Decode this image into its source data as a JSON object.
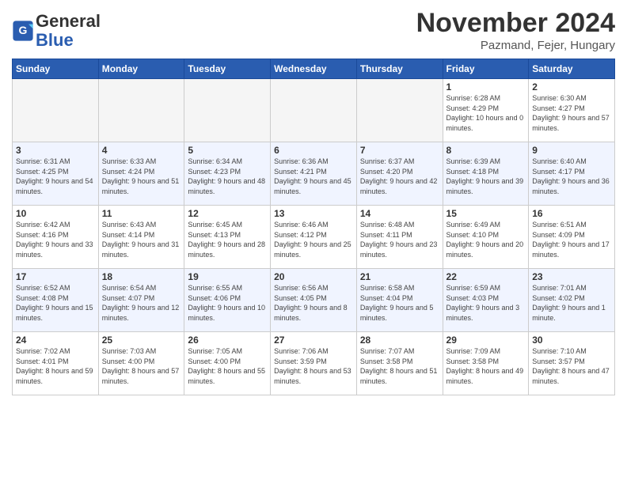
{
  "header": {
    "logo_text_general": "General",
    "logo_text_blue": "Blue",
    "month": "November 2024",
    "location": "Pazmand, Fejer, Hungary"
  },
  "weekdays": [
    "Sunday",
    "Monday",
    "Tuesday",
    "Wednesday",
    "Thursday",
    "Friday",
    "Saturday"
  ],
  "weeks": [
    [
      {
        "day": "",
        "sunrise": "",
        "sunset": "",
        "daylight": "",
        "empty": true
      },
      {
        "day": "",
        "sunrise": "",
        "sunset": "",
        "daylight": "",
        "empty": true
      },
      {
        "day": "",
        "sunrise": "",
        "sunset": "",
        "daylight": "",
        "empty": true
      },
      {
        "day": "",
        "sunrise": "",
        "sunset": "",
        "daylight": "",
        "empty": true
      },
      {
        "day": "",
        "sunrise": "",
        "sunset": "",
        "daylight": "",
        "empty": true
      },
      {
        "day": "1",
        "sunrise": "Sunrise: 6:28 AM",
        "sunset": "Sunset: 4:29 PM",
        "daylight": "Daylight: 10 hours and 0 minutes.",
        "empty": false
      },
      {
        "day": "2",
        "sunrise": "Sunrise: 6:30 AM",
        "sunset": "Sunset: 4:27 PM",
        "daylight": "Daylight: 9 hours and 57 minutes.",
        "empty": false
      }
    ],
    [
      {
        "day": "3",
        "sunrise": "Sunrise: 6:31 AM",
        "sunset": "Sunset: 4:25 PM",
        "daylight": "Daylight: 9 hours and 54 minutes.",
        "empty": false
      },
      {
        "day": "4",
        "sunrise": "Sunrise: 6:33 AM",
        "sunset": "Sunset: 4:24 PM",
        "daylight": "Daylight: 9 hours and 51 minutes.",
        "empty": false
      },
      {
        "day": "5",
        "sunrise": "Sunrise: 6:34 AM",
        "sunset": "Sunset: 4:23 PM",
        "daylight": "Daylight: 9 hours and 48 minutes.",
        "empty": false
      },
      {
        "day": "6",
        "sunrise": "Sunrise: 6:36 AM",
        "sunset": "Sunset: 4:21 PM",
        "daylight": "Daylight: 9 hours and 45 minutes.",
        "empty": false
      },
      {
        "day": "7",
        "sunrise": "Sunrise: 6:37 AM",
        "sunset": "Sunset: 4:20 PM",
        "daylight": "Daylight: 9 hours and 42 minutes.",
        "empty": false
      },
      {
        "day": "8",
        "sunrise": "Sunrise: 6:39 AM",
        "sunset": "Sunset: 4:18 PM",
        "daylight": "Daylight: 9 hours and 39 minutes.",
        "empty": false
      },
      {
        "day": "9",
        "sunrise": "Sunrise: 6:40 AM",
        "sunset": "Sunset: 4:17 PM",
        "daylight": "Daylight: 9 hours and 36 minutes.",
        "empty": false
      }
    ],
    [
      {
        "day": "10",
        "sunrise": "Sunrise: 6:42 AM",
        "sunset": "Sunset: 4:16 PM",
        "daylight": "Daylight: 9 hours and 33 minutes.",
        "empty": false
      },
      {
        "day": "11",
        "sunrise": "Sunrise: 6:43 AM",
        "sunset": "Sunset: 4:14 PM",
        "daylight": "Daylight: 9 hours and 31 minutes.",
        "empty": false
      },
      {
        "day": "12",
        "sunrise": "Sunrise: 6:45 AM",
        "sunset": "Sunset: 4:13 PM",
        "daylight": "Daylight: 9 hours and 28 minutes.",
        "empty": false
      },
      {
        "day": "13",
        "sunrise": "Sunrise: 6:46 AM",
        "sunset": "Sunset: 4:12 PM",
        "daylight": "Daylight: 9 hours and 25 minutes.",
        "empty": false
      },
      {
        "day": "14",
        "sunrise": "Sunrise: 6:48 AM",
        "sunset": "Sunset: 4:11 PM",
        "daylight": "Daylight: 9 hours and 23 minutes.",
        "empty": false
      },
      {
        "day": "15",
        "sunrise": "Sunrise: 6:49 AM",
        "sunset": "Sunset: 4:10 PM",
        "daylight": "Daylight: 9 hours and 20 minutes.",
        "empty": false
      },
      {
        "day": "16",
        "sunrise": "Sunrise: 6:51 AM",
        "sunset": "Sunset: 4:09 PM",
        "daylight": "Daylight: 9 hours and 17 minutes.",
        "empty": false
      }
    ],
    [
      {
        "day": "17",
        "sunrise": "Sunrise: 6:52 AM",
        "sunset": "Sunset: 4:08 PM",
        "daylight": "Daylight: 9 hours and 15 minutes.",
        "empty": false
      },
      {
        "day": "18",
        "sunrise": "Sunrise: 6:54 AM",
        "sunset": "Sunset: 4:07 PM",
        "daylight": "Daylight: 9 hours and 12 minutes.",
        "empty": false
      },
      {
        "day": "19",
        "sunrise": "Sunrise: 6:55 AM",
        "sunset": "Sunset: 4:06 PM",
        "daylight": "Daylight: 9 hours and 10 minutes.",
        "empty": false
      },
      {
        "day": "20",
        "sunrise": "Sunrise: 6:56 AM",
        "sunset": "Sunset: 4:05 PM",
        "daylight": "Daylight: 9 hours and 8 minutes.",
        "empty": false
      },
      {
        "day": "21",
        "sunrise": "Sunrise: 6:58 AM",
        "sunset": "Sunset: 4:04 PM",
        "daylight": "Daylight: 9 hours and 5 minutes.",
        "empty": false
      },
      {
        "day": "22",
        "sunrise": "Sunrise: 6:59 AM",
        "sunset": "Sunset: 4:03 PM",
        "daylight": "Daylight: 9 hours and 3 minutes.",
        "empty": false
      },
      {
        "day": "23",
        "sunrise": "Sunrise: 7:01 AM",
        "sunset": "Sunset: 4:02 PM",
        "daylight": "Daylight: 9 hours and 1 minute.",
        "empty": false
      }
    ],
    [
      {
        "day": "24",
        "sunrise": "Sunrise: 7:02 AM",
        "sunset": "Sunset: 4:01 PM",
        "daylight": "Daylight: 8 hours and 59 minutes.",
        "empty": false
      },
      {
        "day": "25",
        "sunrise": "Sunrise: 7:03 AM",
        "sunset": "Sunset: 4:00 PM",
        "daylight": "Daylight: 8 hours and 57 minutes.",
        "empty": false
      },
      {
        "day": "26",
        "sunrise": "Sunrise: 7:05 AM",
        "sunset": "Sunset: 4:00 PM",
        "daylight": "Daylight: 8 hours and 55 minutes.",
        "empty": false
      },
      {
        "day": "27",
        "sunrise": "Sunrise: 7:06 AM",
        "sunset": "Sunset: 3:59 PM",
        "daylight": "Daylight: 8 hours and 53 minutes.",
        "empty": false
      },
      {
        "day": "28",
        "sunrise": "Sunrise: 7:07 AM",
        "sunset": "Sunset: 3:58 PM",
        "daylight": "Daylight: 8 hours and 51 minutes.",
        "empty": false
      },
      {
        "day": "29",
        "sunrise": "Sunrise: 7:09 AM",
        "sunset": "Sunset: 3:58 PM",
        "daylight": "Daylight: 8 hours and 49 minutes.",
        "empty": false
      },
      {
        "day": "30",
        "sunrise": "Sunrise: 7:10 AM",
        "sunset": "Sunset: 3:57 PM",
        "daylight": "Daylight: 8 hours and 47 minutes.",
        "empty": false
      }
    ]
  ]
}
